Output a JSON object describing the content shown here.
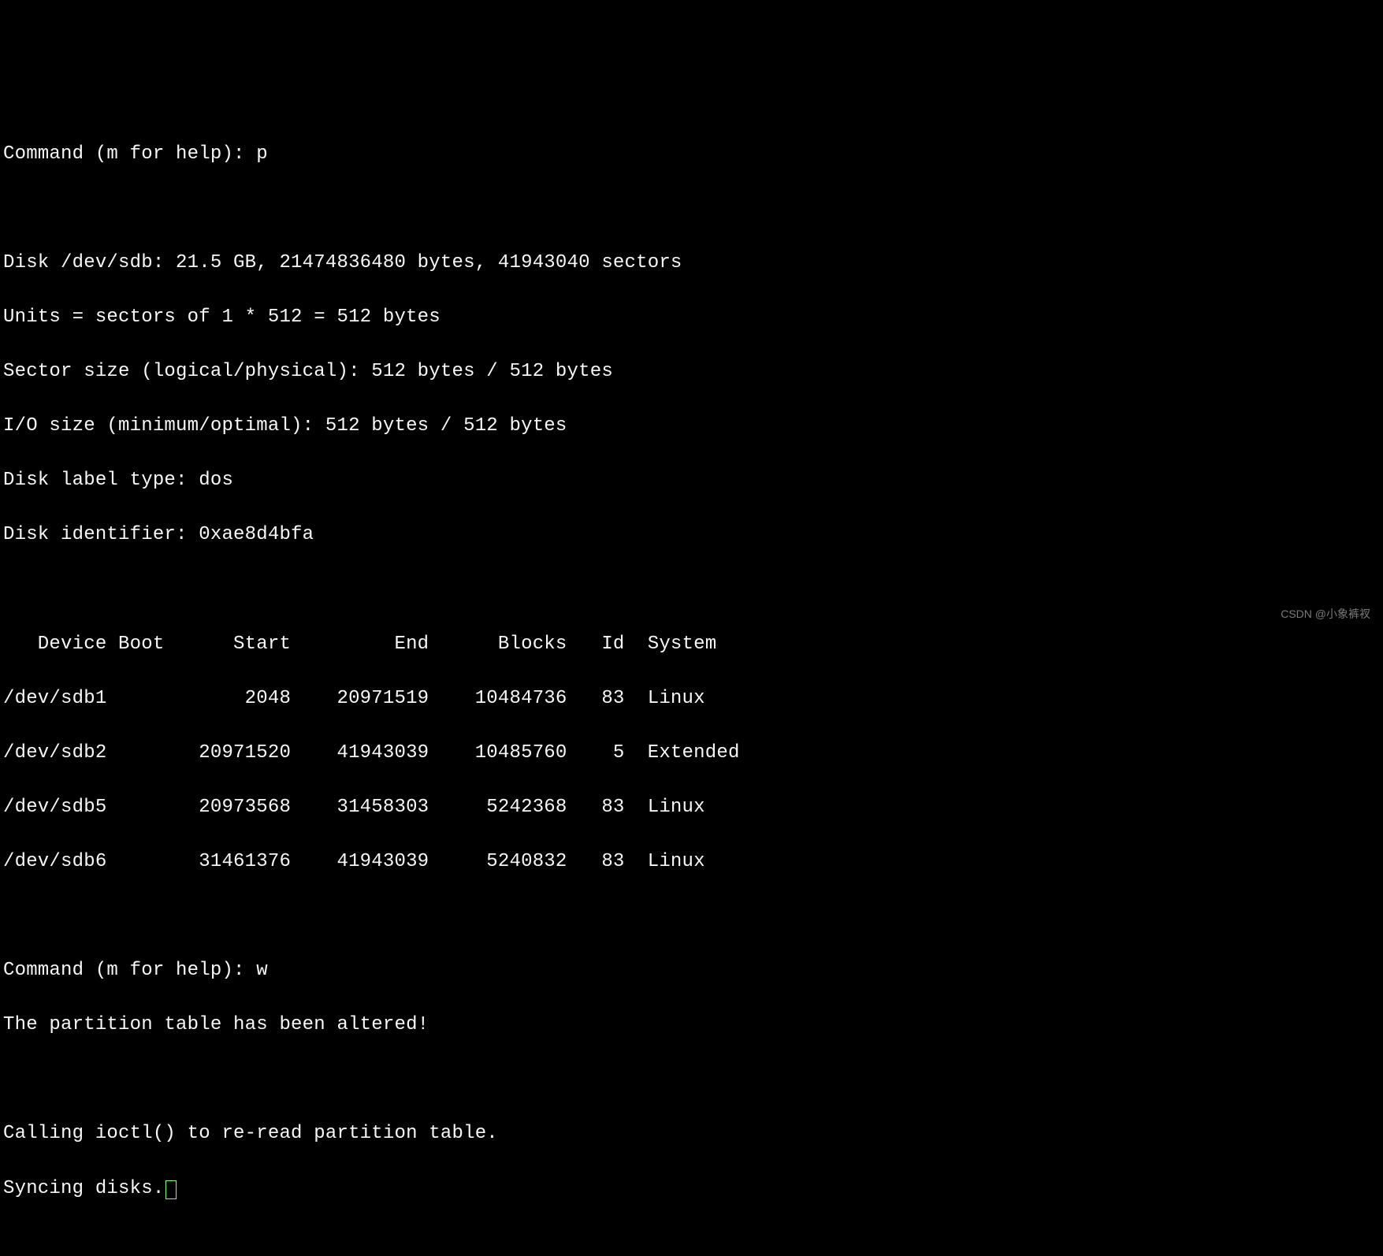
{
  "prompts": {
    "prompt_text": "Command (m for help): ",
    "input_p": "p",
    "input_w": "w"
  },
  "disk_info": {
    "line1": "Disk /dev/sdb: 21.5 GB, 21474836480 bytes, 41943040 sectors",
    "line2": "Units = sectors of 1 * 512 = 512 bytes",
    "line3": "Sector size (logical/physical): 512 bytes / 512 bytes",
    "line4": "I/O size (minimum/optimal): 512 bytes / 512 bytes",
    "line5": "Disk label type: dos",
    "line6": "Disk identifier: 0xae8d4bfa"
  },
  "table": {
    "header": "   Device Boot      Start         End      Blocks   Id  System",
    "rows": [
      "/dev/sdb1            2048    20971519    10484736   83  Linux",
      "/dev/sdb2        20971520    41943039    10485760    5  Extended",
      "/dev/sdb5        20973568    31458303     5242368   83  Linux",
      "/dev/sdb6        31461376    41943039     5240832   83  Linux"
    ]
  },
  "write_output": {
    "altered": "The partition table has been altered!",
    "ioctl": "Calling ioctl() to re-read partition table.",
    "syncing": "Syncing disks."
  },
  "watermark": "CSDN @小象裤衩"
}
